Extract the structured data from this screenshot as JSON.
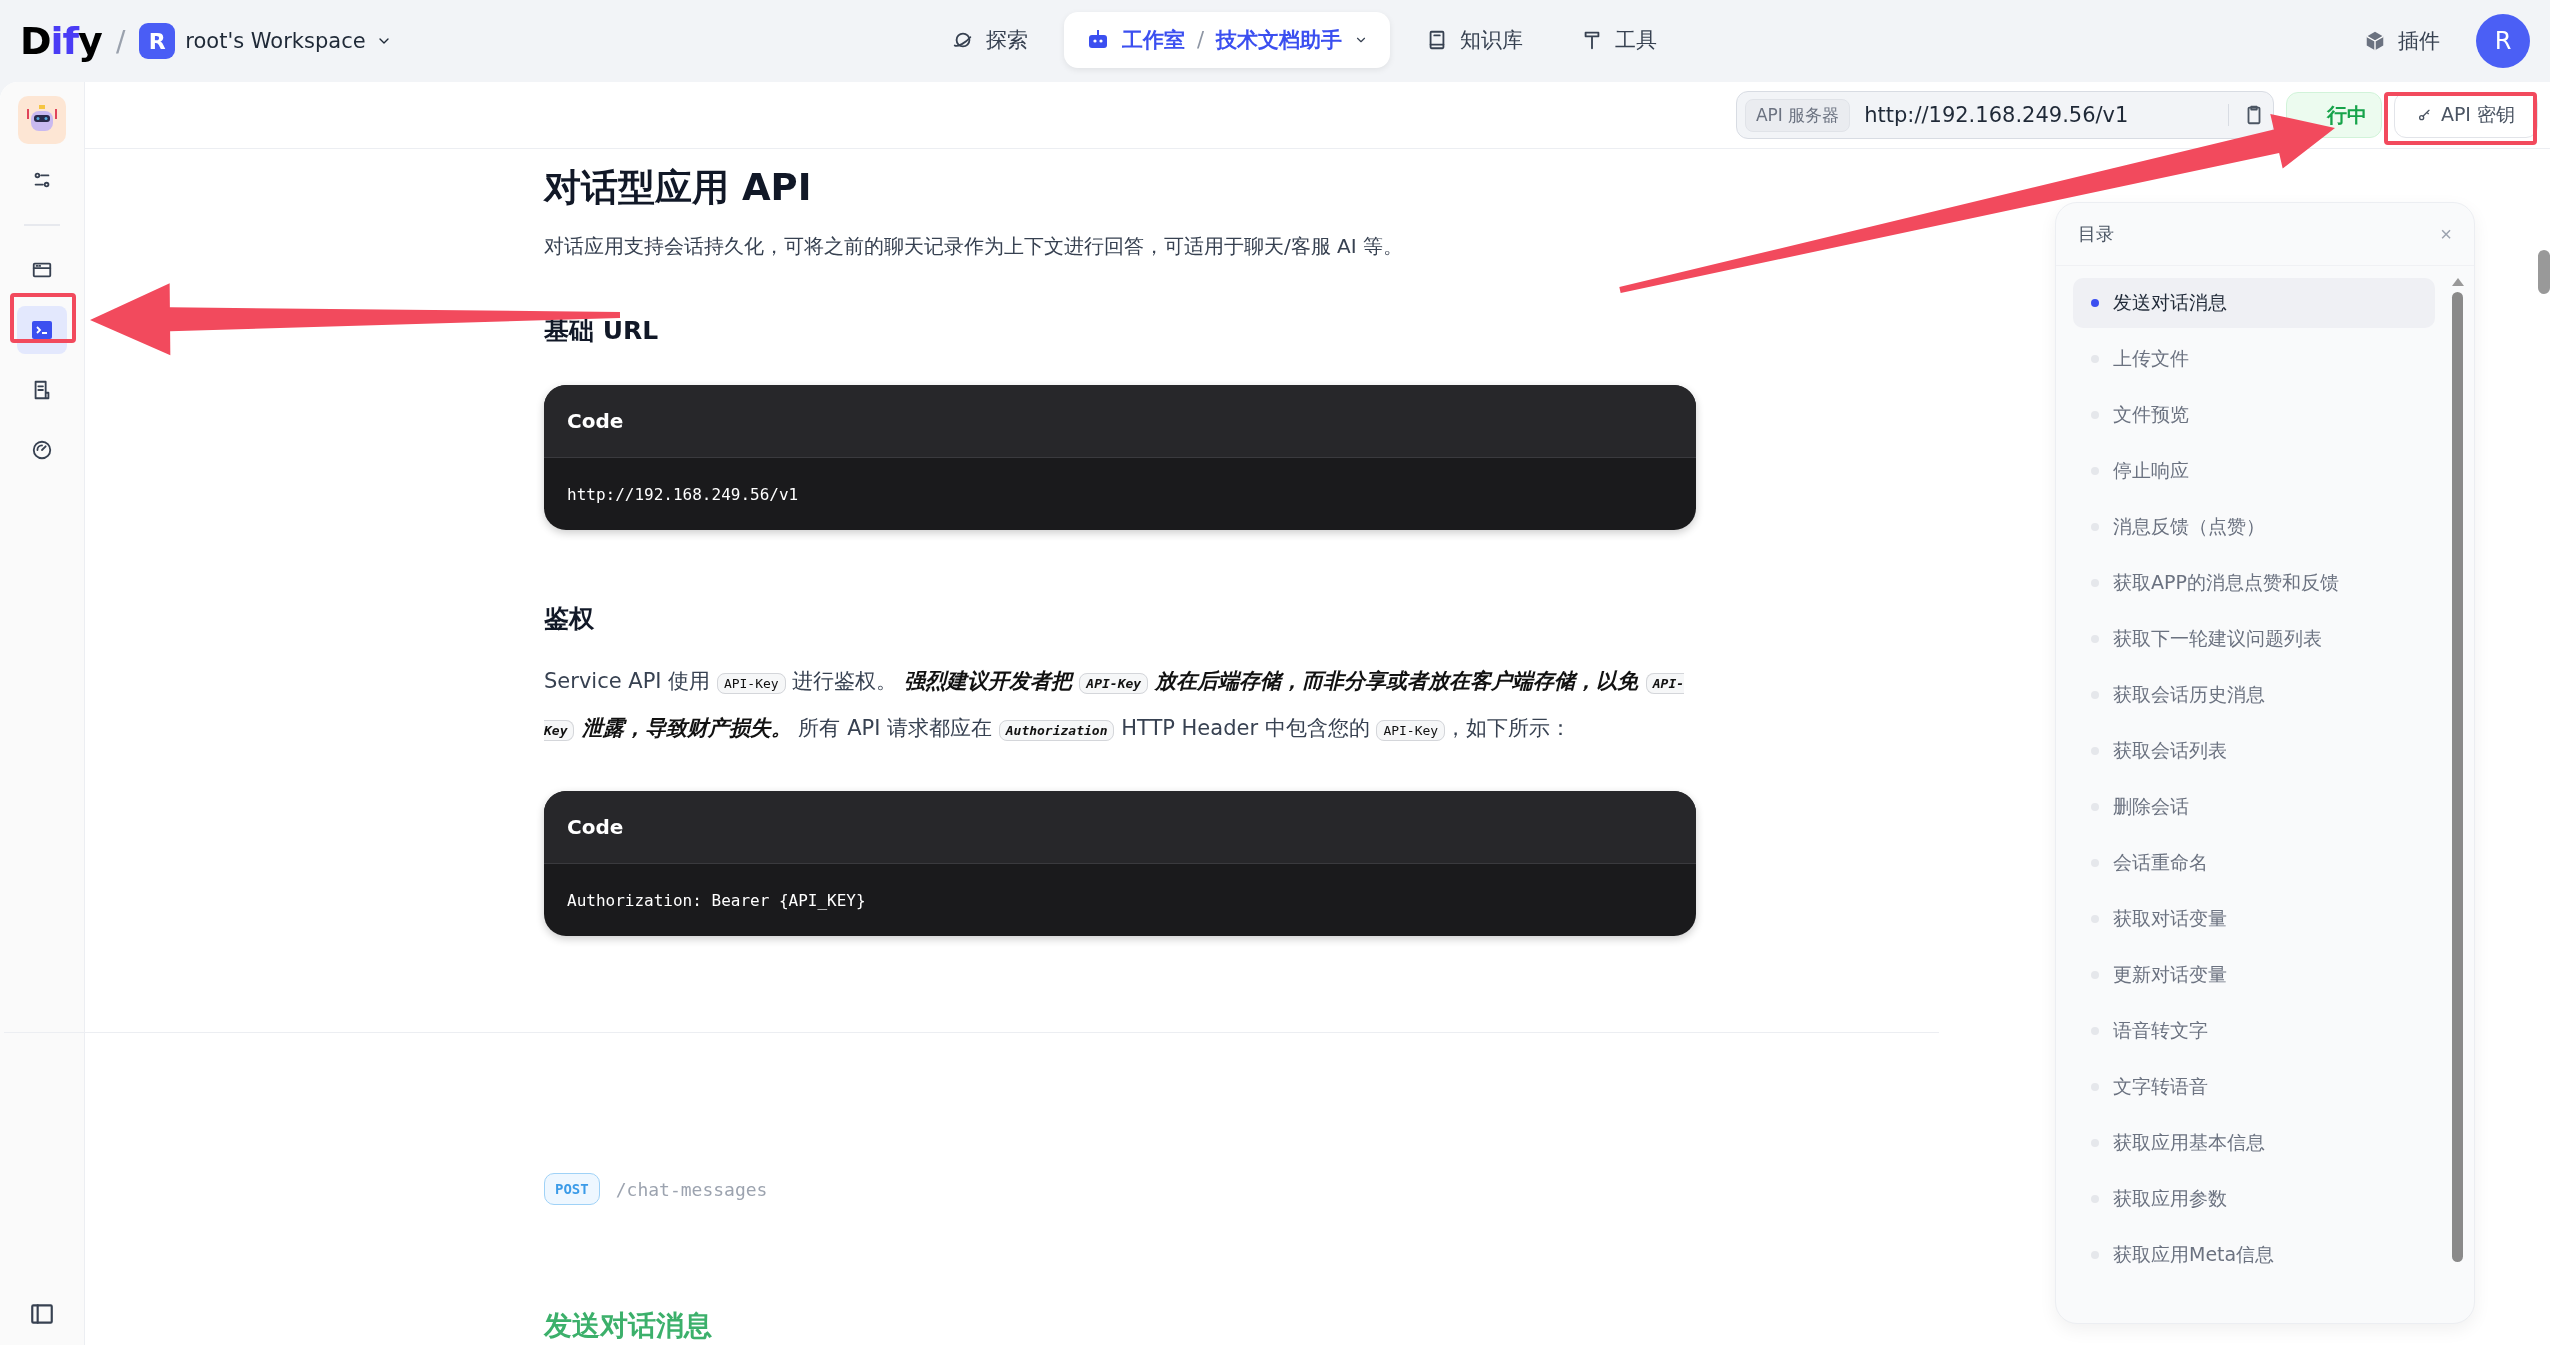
{
  "topbar": {
    "logo": {
      "letters": [
        {
          "text": "D",
          "accent": false
        },
        {
          "text": "if",
          "accent": true
        },
        {
          "text": "y",
          "accent": false
        }
      ]
    },
    "separator": "/",
    "workspace": {
      "initial": "R",
      "name": "root's Workspace"
    },
    "nav": [
      {
        "kind": "plain",
        "label": "探索"
      },
      {
        "kind": "crumb",
        "label": "工作室",
        "separator": "/",
        "app": "技术文档助手",
        "selected": true
      },
      {
        "kind": "plain",
        "label": "知识库"
      },
      {
        "kind": "plain",
        "label": "工具"
      }
    ],
    "plugins": "插件",
    "avatar": "R"
  },
  "sidebar": {
    "items": [
      {
        "selected": false
      },
      {
        "selected": false
      },
      {
        "selected": true
      },
      {
        "selected": false
      },
      {
        "selected": false
      }
    ]
  },
  "api_bar": {
    "server_label": "API 服务器",
    "server_url": "http://192.168.249.56/v1",
    "status": "行中",
    "key_button": "API 密钥"
  },
  "doc": {
    "title": "对话型应用 API",
    "intro": "对话应用支持会话持久化，可将之前的聊天记录作为上下文进行回答，可适用于聊天/客服 AI 等。",
    "sections": [
      {
        "heading": "基础 URL",
        "code_title": "Code",
        "code": "http://192.168.249.56/v1"
      },
      {
        "heading": "鉴权",
        "paragraph": [
          {
            "kind": "text",
            "text": "Service API 使用 "
          },
          {
            "kind": "code",
            "text": "API-Key"
          },
          {
            "kind": "text",
            "text": " 进行鉴权。 "
          },
          {
            "kind": "strong",
            "text": "强烈建议开发者把 "
          },
          {
            "kind": "strongcode",
            "text": "API-Key"
          },
          {
            "kind": "strong",
            "text": " 放在后端存储，而非分享或者放在客户端存储，以免 "
          },
          {
            "kind": "strongcode",
            "text": "API-Key"
          },
          {
            "kind": "strong",
            "text": " 泄露，导致财产损失。"
          },
          {
            "kind": "text",
            "text": " 所有 API 请求都应在 "
          },
          {
            "kind": "strongcode",
            "text": "Authorization"
          },
          {
            "kind": "text",
            "text": " HTTP Header 中包含您的 "
          },
          {
            "kind": "code",
            "text": "API-Key"
          },
          {
            "kind": "text",
            "text": "，如下所示："
          }
        ],
        "code_title": "Code",
        "code": "Authorization: Bearer {API_KEY}"
      }
    ],
    "endpoint": {
      "method": "POST",
      "path": "/chat-messages"
    },
    "next_heading": "发送对话消息"
  },
  "toc": {
    "title": "目录",
    "close": "×",
    "items": [
      {
        "label": "发送对话消息",
        "selected": true
      },
      {
        "label": "上传文件",
        "selected": false
      },
      {
        "label": "文件预览",
        "selected": false
      },
      {
        "label": "停止响应",
        "selected": false
      },
      {
        "label": "消息反馈（点赞）",
        "selected": false
      },
      {
        "label": "获取APP的消息点赞和反馈",
        "selected": false
      },
      {
        "label": "获取下一轮建议问题列表",
        "selected": false
      },
      {
        "label": "获取会话历史消息",
        "selected": false
      },
      {
        "label": "获取会话列表",
        "selected": false
      },
      {
        "label": "删除会话",
        "selected": false
      },
      {
        "label": "会话重命名",
        "selected": false
      },
      {
        "label": "获取对话变量",
        "selected": false
      },
      {
        "label": "更新对话变量",
        "selected": false
      },
      {
        "label": "语音转文字",
        "selected": false
      },
      {
        "label": "文字转语音",
        "selected": false
      },
      {
        "label": "获取应用基本信息",
        "selected": false
      },
      {
        "label": "获取应用参数",
        "selected": false
      },
      {
        "label": "获取应用Meta信息",
        "selected": false
      }
    ]
  }
}
